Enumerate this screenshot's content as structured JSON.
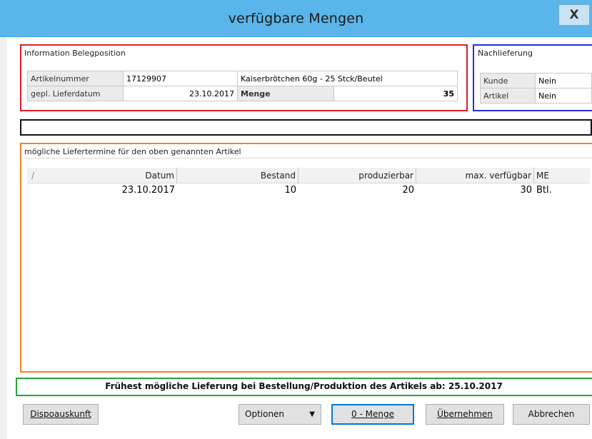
{
  "window": {
    "title": "verfügbare Mengen",
    "close_label": "X"
  },
  "belegposition": {
    "title": "Information Belegposition",
    "artikelnummer_label": "Artikelnummer",
    "artikelnummer": "17129907",
    "artikel_bezeichnung": "Kaiserbrötchen 60g - 25 Stck/Beutel",
    "lieferdatum_label": "gepl. Lieferdatum",
    "lieferdatum": "23.10.2017",
    "menge_label": "Menge",
    "menge": "35"
  },
  "nachlieferung": {
    "title": "Nachlieferung",
    "kunde_label": "Kunde",
    "kunde": "Nein",
    "artikel_label": "Artikel",
    "artikel": "Nein"
  },
  "liefertermine": {
    "title": "mögliche Liefertermine für den oben genannten Artikel",
    "columns": {
      "sort": "/",
      "datum": "Datum",
      "bestand": "Bestand",
      "produzierbar": "produzierbar",
      "max_verfuegbar": "max. verfügbar",
      "me": "ME"
    },
    "rows": [
      {
        "datum": "23.10.2017",
        "bestand": "10",
        "produzierbar": "20",
        "max_verfuegbar": "30",
        "me": "Btl."
      }
    ]
  },
  "footer": {
    "message": "Frühest mögliche Lieferung bei Bestellung/Produktion des Artikels ab: 25.10.2017"
  },
  "buttons": {
    "dispoauskunft": "Dispoauskunft",
    "optionen": "Optionen",
    "null_menge": "0 - Menge",
    "uebernehmen": "Übernehmen",
    "abbrechen": "Abbrechen"
  },
  "colors": {
    "titlebar": "#5ab5eb",
    "belegposition_border": "#e21b2d",
    "nachlieferung_border": "#2a2ed8",
    "liefertermine_border": "#f58220",
    "footer_border": "#27a23c"
  }
}
